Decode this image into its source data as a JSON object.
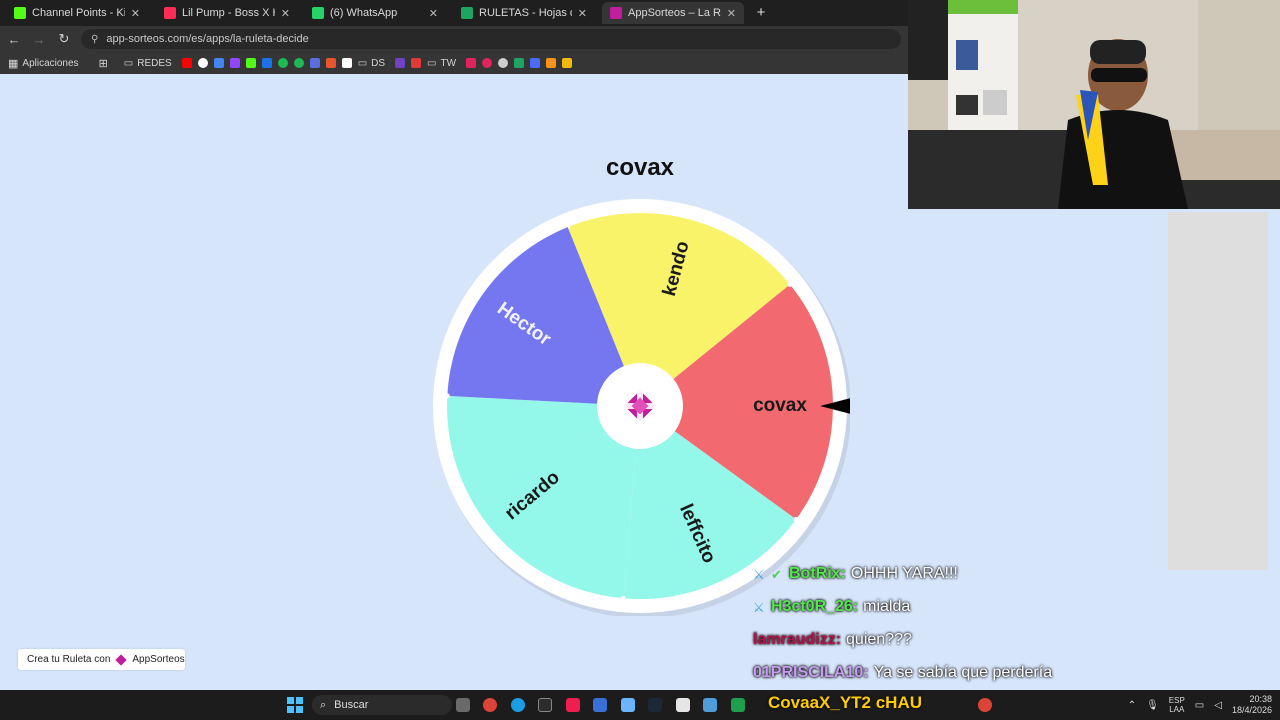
{
  "browser": {
    "tabs": [
      {
        "title": "Channel Points - Kick Dashboa",
        "icon_color": "#53fc18",
        "active": false
      },
      {
        "title": "Lil Pump - Boss X Hunnid d",
        "icon_color": "#ff2d55",
        "active": false
      },
      {
        "title": "(6) WhatsApp",
        "icon_color": "#25d366",
        "active": false
      },
      {
        "title": "RULETAS - Hojas de cálculo de",
        "icon_color": "#1fa463",
        "active": false
      },
      {
        "title": "AppSorteos – La Ruleta de",
        "icon_color": "#c21d9a",
        "active": true
      }
    ],
    "url": "app-sorteos.com/es/apps/la-ruleta-decide",
    "bookmarks": [
      "Aplicaciones",
      "REDES",
      "DS",
      "TW"
    ]
  },
  "wheel": {
    "winner": "covax",
    "segments": [
      {
        "name": "kendo",
        "color": "#f9f36a"
      },
      {
        "name": "covax",
        "color": "#f26a70"
      },
      {
        "name": "leffcito",
        "color": "#93f7e9"
      },
      {
        "name": "ricardo",
        "color": "#93f7e9"
      },
      {
        "name": "Hector",
        "color": "#7577f0"
      }
    ],
    "rim_color": "#ffffff",
    "logo_color": "#c21d9a"
  },
  "credit": {
    "text": "Crea tu Ruleta con",
    "brand": "AppSorteos"
  },
  "chat": [
    {
      "user": "BotRix:",
      "user_color": "#52e84a",
      "message": "OHHH YARA!!!",
      "badges": [
        "sword",
        "check"
      ]
    },
    {
      "user": "H3ct0R_26:",
      "user_color": "#52e84a",
      "message": "mialda",
      "badges": [
        "sword"
      ]
    },
    {
      "user": "lamraudizz:",
      "user_color": "#b3124a",
      "message": "quien???",
      "badges": []
    },
    {
      "user": "01PRISCILA10:",
      "user_color": "#c79cf0",
      "message": "Ya se sabía que perdería",
      "badges": []
    }
  ],
  "taskbar": {
    "search_placeholder": "Buscar",
    "overlay_text": "CovaaX_YT2 cHAU",
    "language": "ESP",
    "language_sub": "LAA",
    "time": "20:38",
    "date": "18/4/2026"
  }
}
